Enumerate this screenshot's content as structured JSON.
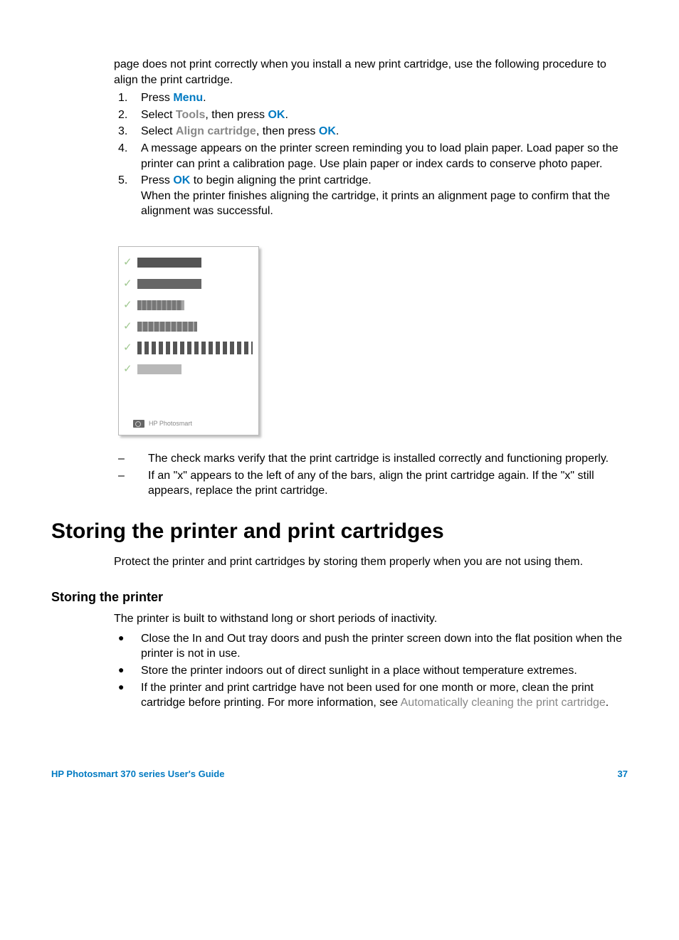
{
  "intro": "page does not print correctly when you install a new print cartridge, use the following procedure to align the print cartridge.",
  "steps": {
    "s1": {
      "num": "1.",
      "pre": "Press ",
      "menu": "Menu",
      "post": "."
    },
    "s2": {
      "num": "2.",
      "pre": "Select ",
      "tools": "Tools",
      "mid": ", then press ",
      "ok": "OK",
      "post": "."
    },
    "s3": {
      "num": "3.",
      "pre": "Select ",
      "align": "Align cartridge",
      "mid": ", then press ",
      "ok": "OK",
      "post": "."
    },
    "s4": {
      "num": "4.",
      "text": "A message appears on the printer screen reminding you to load plain paper. Load paper so the printer can print a calibration page. Use plain paper or index cards to conserve photo paper."
    },
    "s5": {
      "num": "5.",
      "pre": "Press ",
      "ok": "OK",
      "post": " to begin aligning the print cartridge.",
      "line2": "When the printer finishes aligning the cartridge, it prints an alignment page to confirm that the alignment was successful."
    }
  },
  "figure": {
    "footer": "HP Photosmart"
  },
  "checks": {
    "d1": "The check marks verify that the print cartridge is installed correctly and functioning properly.",
    "d2": "If an \"x\" appears to the left of any of the bars, align the print cartridge again. If the \"x\" still appears, replace the print cartridge."
  },
  "h1": "Storing the printer and print cartridges",
  "p1": "Protect the printer and print cartridges by storing them properly when you are not using them.",
  "h2": "Storing the printer",
  "p2": "The printer is built to withstand long or short periods of inactivity.",
  "bullets": {
    "b1": "Close the In and Out tray doors and push the printer screen down into the flat position when the printer is not in use.",
    "b2": "Store the printer indoors out of direct sunlight in a place without temperature extremes.",
    "b3pre": "If the printer and print cartridge have not been used for one month or more, clean the print cartridge before printing. For more information, see ",
    "b3link": "Automatically cleaning the print cartridge",
    "b3post": "."
  },
  "footer": {
    "left": "HP Photosmart 370 series User's Guide",
    "right": "37"
  }
}
